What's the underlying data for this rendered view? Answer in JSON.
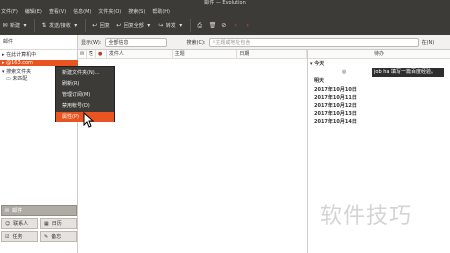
{
  "window": {
    "title": "邮件 — Evolution"
  },
  "menubar": [
    "文件(F)",
    "编辑(E)",
    "查看(V)",
    "信息(M)",
    "文件夹(O)",
    "搜索(S)",
    "帮助(H)"
  ],
  "toolbar": {
    "new_label": "新建",
    "send_receive_label": "发送/接收",
    "reply_label": "回复",
    "reply_all_label": "回复全部",
    "forward_label": "转发"
  },
  "sidebar": {
    "header": "邮件",
    "on_this_computer": "在此计算机中",
    "account_suffix": "@163.com",
    "search_folders": "搜索文件夹",
    "unmatched": "未匹配"
  },
  "filterbar": {
    "show_label": "显示(W):",
    "show_value": "全部信息",
    "search_label": "搜索(C):",
    "search_placeholder": "主题或地址包含",
    "in_label": "在(N)"
  },
  "message_list": {
    "columns": [
      "发件人",
      "主题",
      "日期"
    ]
  },
  "context_menu": {
    "items": [
      "新建文件夹(N)...",
      "刷新(R)",
      "管理订阅(M)",
      "禁用帐号(D)",
      "属性(P)"
    ],
    "active_index": 4
  },
  "todo": {
    "header": "待办",
    "today": "今天",
    "task_text": "job ha 填写一篇百度经验。",
    "tomorrow": "明天",
    "dates": [
      "2017年10月10日",
      "2017年10月11日",
      "2017年10月12日",
      "2017年10月13日",
      "2017年10月14日"
    ]
  },
  "modes": {
    "mail": "邮件",
    "contacts": "联系人",
    "calendar": "日历",
    "tasks": "任务",
    "memos": "备忘"
  },
  "watermark": "软件技巧",
  "colors": {
    "accent": "#e95420",
    "chrome": "#3c3b37"
  }
}
